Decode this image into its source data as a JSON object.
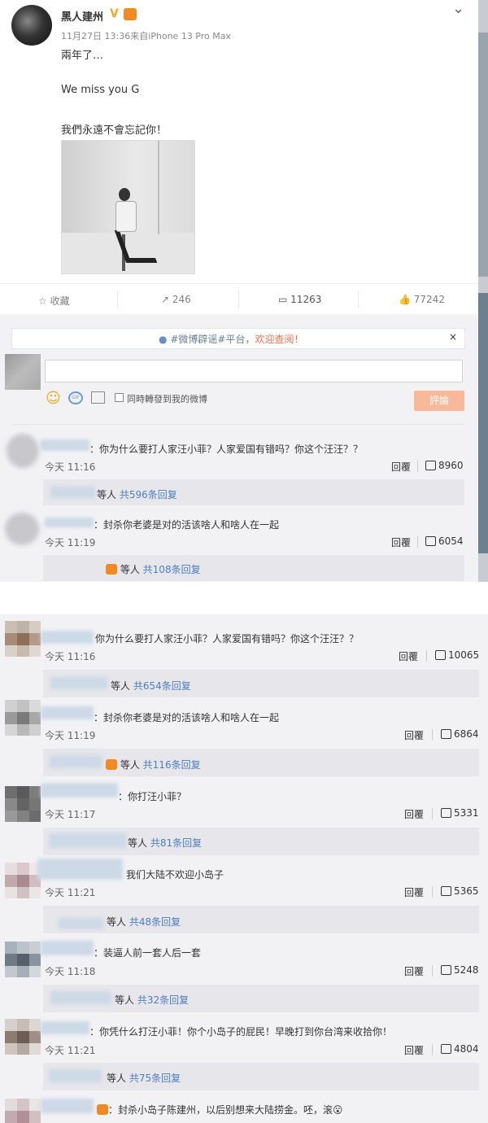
{
  "post": {
    "username": "黑人建州",
    "verified_mark": "V",
    "meta": "11月27日 13:36来自iPhone 13 Pro Max",
    "lines": [
      "兩年了…",
      "We miss you  G",
      "我們永遠不會忘記你！"
    ],
    "chevron": "⌄"
  },
  "actions": {
    "favorite": "收藏",
    "forward_count": "246",
    "comment_count": "11263",
    "like_count": "77242"
  },
  "comment_box": {
    "notice_prefix": "#微博辟谣#平台，",
    "notice_link": "欢迎查阅！",
    "close": "×",
    "sync_label": "同時轉發到我的微博",
    "submit_label": "評論"
  },
  "thread1": [
    {
      "text": "：你为什么要打人家汪小菲？人家爱国有错吗？你这个汪汪？？",
      "time": "今天 11:16",
      "reply": "回覆",
      "likes": "8960",
      "reply_prefix": "等人",
      "reply_link": "共596条回复"
    },
    {
      "text": "：封杀你老婆是对的活该啥人和啥人在一起",
      "time": "今天 11:19",
      "reply": "回覆",
      "likes": "6054",
      "reply_prefix": "等人",
      "reply_link": "共108条回复"
    }
  ],
  "thread2": [
    {
      "text": "你为什么要打人家汪小菲？人家爱国有错吗？你这个汪汪？？",
      "time": "今天 11:16",
      "reply": "回覆",
      "likes": "10065",
      "reply_prefix": "等人",
      "reply_link": "共654条回复"
    },
    {
      "text": "：封杀你老婆是对的活该啥人和啥人在一起",
      "time": "今天 11:19",
      "reply": "回覆",
      "likes": "6864",
      "reply_prefix": "等人",
      "reply_link": "共116条回复"
    },
    {
      "text": "：你打汪小菲？",
      "time": "今天 11:17",
      "reply": "回覆",
      "likes": "5331",
      "reply_prefix": "等人",
      "reply_link": "共81条回复"
    },
    {
      "text": "我们大陆不欢迎小岛子",
      "time": "今天 11:21",
      "reply": "回覆",
      "likes": "5365",
      "reply_prefix": "等人",
      "reply_link": "共48条回复"
    },
    {
      "text": "：装逼人前一套人后一套",
      "time": "今天 11:18",
      "reply": "回覆",
      "likes": "5248",
      "reply_prefix": "等人",
      "reply_link": "共32条回复"
    },
    {
      "text": "：你凭什么打汪小菲！你个小岛子的屁民！早晚打到你台湾来收拾你！",
      "time": "今天 11:21",
      "reply": "回覆",
      "likes": "4804",
      "reply_prefix": "等人",
      "reply_link": "共75条回复"
    },
    {
      "text": "：封杀小岛子陈建州，以后别想来大陆捞金。呸，滚😮"
    }
  ]
}
